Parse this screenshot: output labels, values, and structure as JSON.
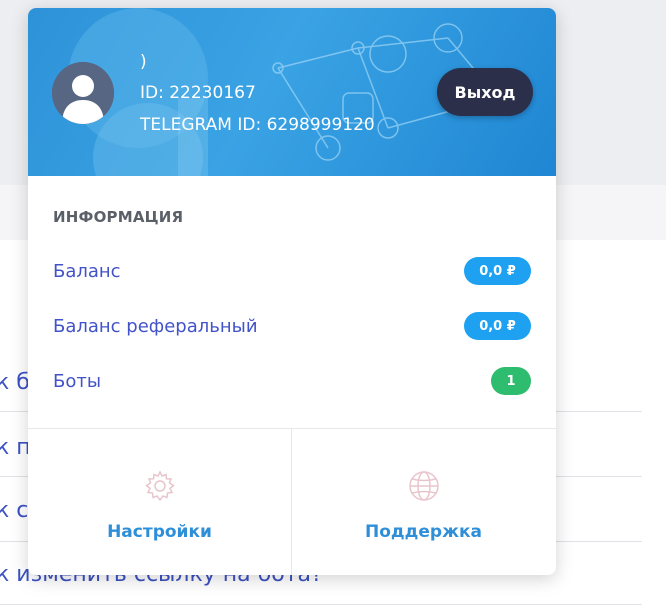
{
  "background": {
    "links": [
      "к бе",
      "к пе",
      "к сд",
      "к изменить ссылку на бота?"
    ]
  },
  "profile": {
    "name": ")",
    "id_text": "ID: 22230167",
    "telegram_text": "TELEGRAM ID: 6298999120",
    "logout_label": "Выход",
    "avatar_icon": "user-avatar-icon"
  },
  "info": {
    "title": "ИНФОРМАЦИЯ",
    "rows": [
      {
        "label": "Баланс",
        "value": "0,0 ₽",
        "color": "#1ea1f1"
      },
      {
        "label": "Баланс реферальный",
        "value": "0,0 ₽",
        "color": "#1ea1f1"
      },
      {
        "label": "Боты",
        "value": "1",
        "color": "#2ebd6e"
      }
    ]
  },
  "actions": [
    {
      "label": "Настройки",
      "icon": "gear-icon"
    },
    {
      "label": "Поддержка",
      "icon": "globe-icon"
    }
  ],
  "colors": {
    "header": "#2e92d8",
    "link": "#4253c9",
    "action": "#2e8fd8",
    "logout_bg": "#2b2f4a"
  }
}
